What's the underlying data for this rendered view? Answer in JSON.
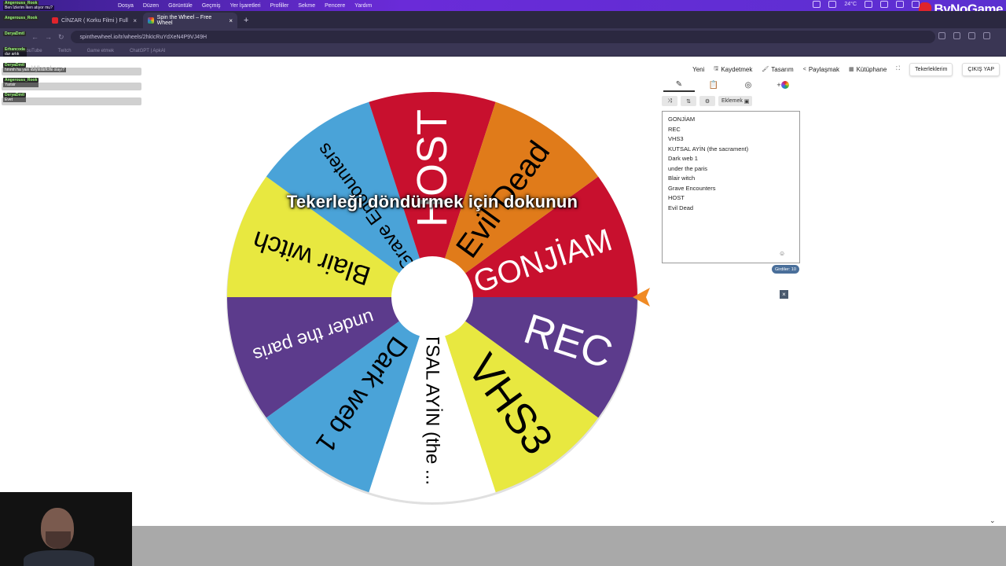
{
  "menubar": {
    "items": [
      "Dosya",
      "Düzen",
      "Görüntüle",
      "Geçmiş",
      "Yer İşaretleri",
      "Profiller",
      "Sekme",
      "Pencere",
      "Yardım"
    ],
    "temperature": "24°C"
  },
  "brand_overlay": "ByNoGame",
  "browser": {
    "tabs": [
      {
        "title": "CİNZAR ( Korku Filmi ) Full",
        "active": false
      },
      {
        "title": "Spin the Wheel – Free Wheel",
        "active": true
      }
    ],
    "url": "spinthewheel.io/tr/wheels/2hkIcRuYdXeN4P9VJ49H",
    "bookmarks": [
      "YouTube",
      "Twitch",
      "Game etmek",
      "ChatGPT | ApkAI"
    ]
  },
  "chat": [
    {
      "user": "Angerouss_Rook",
      "text": "Ben İzlerim İken atıyor mu?"
    },
    {
      "user": "Angerouss_Rook",
      "text": ""
    },
    {
      "user": "DeryaDmtl",
      "text": ""
    },
    {
      "user": "Erhancoda",
      "text": "dur artık"
    },
    {
      "user": "DeryaDmtl",
      "text": "hmmh ha yani kleysistim mi olayı?"
    },
    {
      "user": "Angerouss_Rook",
      "text": "Yarisir"
    },
    {
      "user": "DeryaDmtl",
      "text": "Evet"
    }
  ],
  "site_brand_faint": "Wheel",
  "nav": {
    "new": "Yeni",
    "save": "Kaydetmek",
    "design": "Tasarım",
    "share": "Paylaşmak",
    "library": "Kütüphane",
    "my_wheels": "Tekerleklerim",
    "logout": "ÇIKIŞ YAP"
  },
  "wheel": {
    "overlay": "Tekerleği döndürmek için dokunun",
    "segments": [
      {
        "label": "GONJİAM",
        "color": "#c8102e",
        "text_color": "#ffffff"
      },
      {
        "label": "REC",
        "color": "#5c3b8c",
        "text_color": "#ffffff"
      },
      {
        "label": "VHS3",
        "color": "#e8e840",
        "text_color": "#000000"
      },
      {
        "label": "KUTSAL AYİN (the ...",
        "color": "#ffffff",
        "text_color": "#000000"
      },
      {
        "label": "Dark web 1",
        "color": "#4aa3d8",
        "text_color": "#000000"
      },
      {
        "label": "under the paris",
        "color": "#5c3b8c",
        "text_color": "#ffffff"
      },
      {
        "label": "Blair witch",
        "color": "#e8e840",
        "text_color": "#000000"
      },
      {
        "label": "Grave Encounters",
        "color": "#4aa3d8",
        "text_color": "#000000"
      },
      {
        "label": "HOST",
        "color": "#c8102e",
        "text_color": "#ffffff"
      },
      {
        "label": "Evil Dead",
        "color": "#e07b1a",
        "text_color": "#000000"
      }
    ],
    "pointer_color": "#f08a24"
  },
  "editor": {
    "add_button": "Eklemek",
    "entries": [
      "GONJİAM",
      "REC",
      "VHS3",
      "KUTSAL AYİN (the sacrament)",
      "Dark web 1",
      "under the paris",
      "Blair witch",
      "Grave Encounters",
      "HOST",
      "Evil Dead"
    ],
    "count_label": "Girdiler: 10"
  }
}
